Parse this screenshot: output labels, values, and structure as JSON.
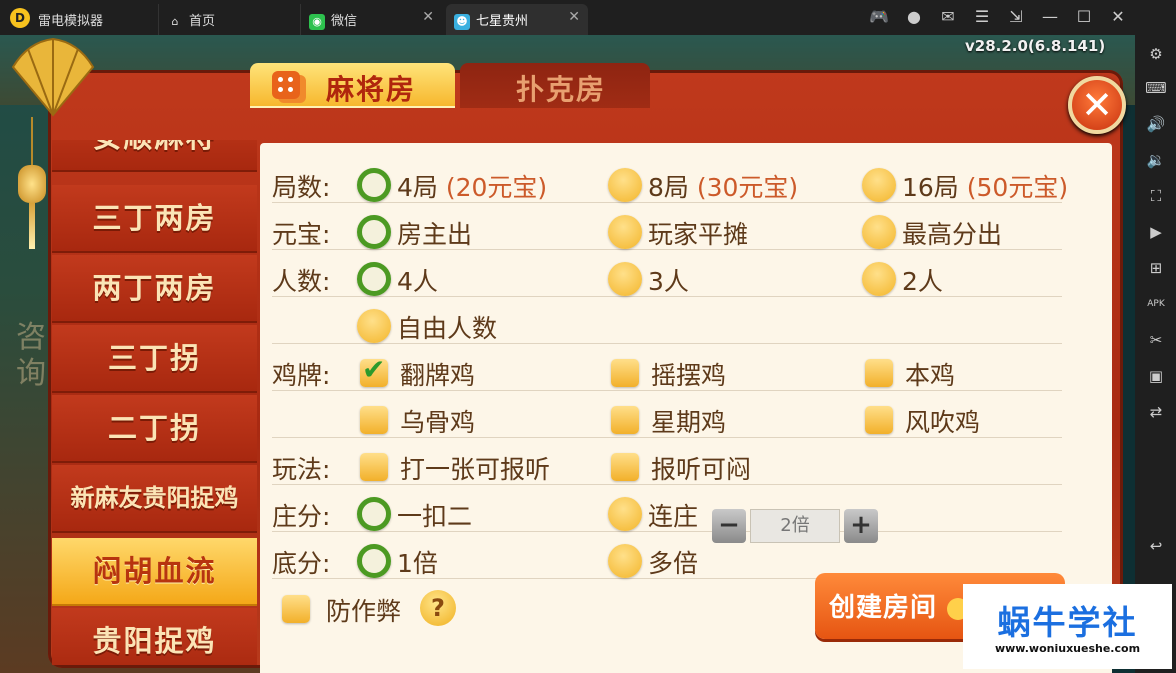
{
  "titlebar": {
    "app_name": "雷电模拟器",
    "tabs": [
      {
        "label": "首页",
        "icon": "home-icon"
      },
      {
        "label": "微信",
        "icon": "wechat-icon"
      },
      {
        "label": "七星贵州",
        "icon": "game-icon"
      }
    ],
    "window_icons": [
      "gamepad-icon",
      "account-icon",
      "mail-icon",
      "menu-icon",
      "resize-icon",
      "minimize-icon",
      "maximize-icon",
      "close-icon"
    ]
  },
  "right_toolbar": [
    "settings-icon",
    "keyboard-icon",
    "volume-up-icon",
    "volume-down-icon",
    "screenshot-icon",
    "record-icon",
    "add-app-icon",
    "apk-install-icon",
    "scissors-icon",
    "video-icon",
    "sync-icon",
    "back-icon"
  ],
  "game": {
    "version": "v28.2.0(6.8.141)",
    "ghost_text": "咨\n询",
    "tabs": {
      "mahjong": "麻将房",
      "poker": "扑克房"
    },
    "close_label": "✕",
    "sidebar": [
      {
        "label": "安顺麻将",
        "active": false
      },
      {
        "label": "三丁两房",
        "active": false
      },
      {
        "label": "两丁两房",
        "active": false
      },
      {
        "label": "三丁拐",
        "active": false
      },
      {
        "label": "二丁拐",
        "active": false
      },
      {
        "label": "新麻友贵阳捉鸡",
        "active": false
      },
      {
        "label": "闷胡血流",
        "active": true
      },
      {
        "label": "贵阳捉鸡",
        "active": false
      }
    ],
    "options": {
      "rounds": {
        "label": "局数:",
        "items": [
          {
            "text": "4局",
            "note": "(20元宝)",
            "selected": true
          },
          {
            "text": "8局",
            "note": "(30元宝)",
            "selected": false
          },
          {
            "text": "16局",
            "note": "(50元宝)",
            "selected": false
          }
        ]
      },
      "ingot": {
        "label": "元宝:",
        "items": [
          {
            "text": "房主出",
            "selected": true
          },
          {
            "text": "玩家平摊",
            "selected": false
          },
          {
            "text": "最高分出",
            "selected": false
          }
        ]
      },
      "players": {
        "label": "人数:",
        "items": [
          {
            "text": "4人",
            "selected": true
          },
          {
            "text": "3人",
            "selected": false
          },
          {
            "text": "2人",
            "selected": false
          },
          {
            "text": "自由人数",
            "selected": false
          }
        ]
      },
      "chicken": {
        "label": "鸡牌:",
        "items": [
          {
            "text": "翻牌鸡",
            "checked": true
          },
          {
            "text": "摇摆鸡",
            "checked": false
          },
          {
            "text": "本鸡",
            "checked": false
          },
          {
            "text": "乌骨鸡",
            "checked": false
          },
          {
            "text": "星期鸡",
            "checked": false
          },
          {
            "text": "风吹鸡",
            "checked": false
          }
        ]
      },
      "play": {
        "label": "玩法:",
        "items": [
          {
            "text": "打一张可报听",
            "checked": false
          },
          {
            "text": "报听可闷",
            "checked": false
          }
        ]
      },
      "dealer": {
        "label": "庄分:",
        "items": [
          {
            "text": "一扣二",
            "selected": true
          },
          {
            "text": "连庄",
            "selected": false
          }
        ]
      },
      "base": {
        "label": "底分:",
        "items": [
          {
            "text": "1倍",
            "selected": true
          },
          {
            "text": "多倍",
            "selected": false
          }
        ],
        "stepper_value": "2倍",
        "minus": "−",
        "plus": "+"
      }
    },
    "anti_cheat": {
      "text": "防作弊",
      "checked": false
    },
    "help_label": "?",
    "create_label": "创建房间"
  },
  "watermark": {
    "title": "蜗牛学社",
    "url": "www.woniuxueshe.com"
  }
}
